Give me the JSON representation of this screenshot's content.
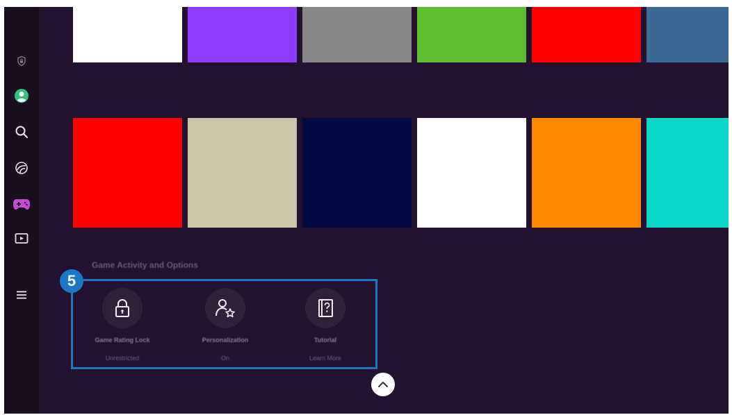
{
  "sidebar": {
    "items": [
      {
        "icon": "shield-lock-icon",
        "active": false
      },
      {
        "icon": "profile-icon",
        "active": false
      },
      {
        "icon": "search-icon",
        "active": false
      },
      {
        "icon": "ambient-icon",
        "active": false
      },
      {
        "icon": "game-controller-icon",
        "active": true
      },
      {
        "icon": "media-icon",
        "active": false
      },
      {
        "icon": "menu-icon",
        "active": false
      }
    ]
  },
  "tiles": {
    "row1": [
      "#ffffff",
      "#8e3dff",
      "#878787",
      "#5dbe2d",
      "#ff0000",
      "#3a6a95"
    ],
    "row2": [
      "#ff0000",
      "#cdc3a6",
      "#020b42",
      "#ffffff",
      "#ff8800",
      "#09d6c6"
    ]
  },
  "section": {
    "title": "Game Activity and Options",
    "step_number": "5"
  },
  "options": [
    {
      "label": "Game Rating Lock",
      "value": "Unrestricted",
      "icon": "lock-icon"
    },
    {
      "label": "Personalization",
      "value": "On",
      "icon": "person-star-icon"
    },
    {
      "label": "Tutorial",
      "value": "Learn More",
      "icon": "tutorial-book-icon"
    }
  ],
  "colors": {
    "background": "#23122f",
    "sidebar": "#1a0f21",
    "highlight": "#1c78c7",
    "active_icon": "#c84bd6"
  }
}
